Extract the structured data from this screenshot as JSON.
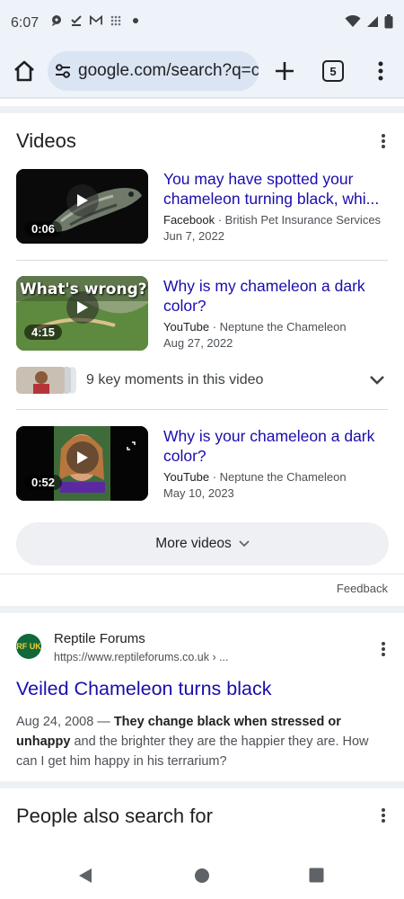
{
  "status": {
    "time": "6:07"
  },
  "browser": {
    "url": "google.com/search?q=ca",
    "tab_count": "5"
  },
  "videos": {
    "title": "Videos",
    "items": [
      {
        "title": "You may have spotted your chameleon turning black, whi...",
        "source": "Facebook",
        "channel": " · British Pet Insurance Services",
        "date": "Jun 7, 2022",
        "duration": "0:06"
      },
      {
        "title": "Why is my chameleon a dark color?",
        "source": "YouTube",
        "channel": " · Neptune the Chameleon",
        "date": "Aug 27, 2022",
        "duration": "4:15",
        "overlay_text": "What's wrong?"
      },
      {
        "title": "Why is your chameleon a dark color?",
        "source": "YouTube",
        "channel": " · Neptune the Chameleon",
        "date": "May 10, 2023",
        "duration": "0:52"
      }
    ],
    "key_moments": "9 key moments in this video",
    "more_label": "More videos"
  },
  "feedback": "Feedback",
  "result": {
    "site_name": "Reptile Forums",
    "url": "https://www.reptileforums.co.uk › ...",
    "favicon_text": "RF UK",
    "title": "Veiled Chameleon turns black",
    "date": "Aug 24, 2008 — ",
    "snippet_bold": "They change black when stressed or unhappy",
    "snippet_rest": " and the brighter they are the happier they are. How can I get him happy in his terrarium?"
  },
  "people_also": {
    "title": "People also search for"
  },
  "colors": {
    "link": "#1a0dab",
    "toolbar_bg": "#eef2f9"
  }
}
